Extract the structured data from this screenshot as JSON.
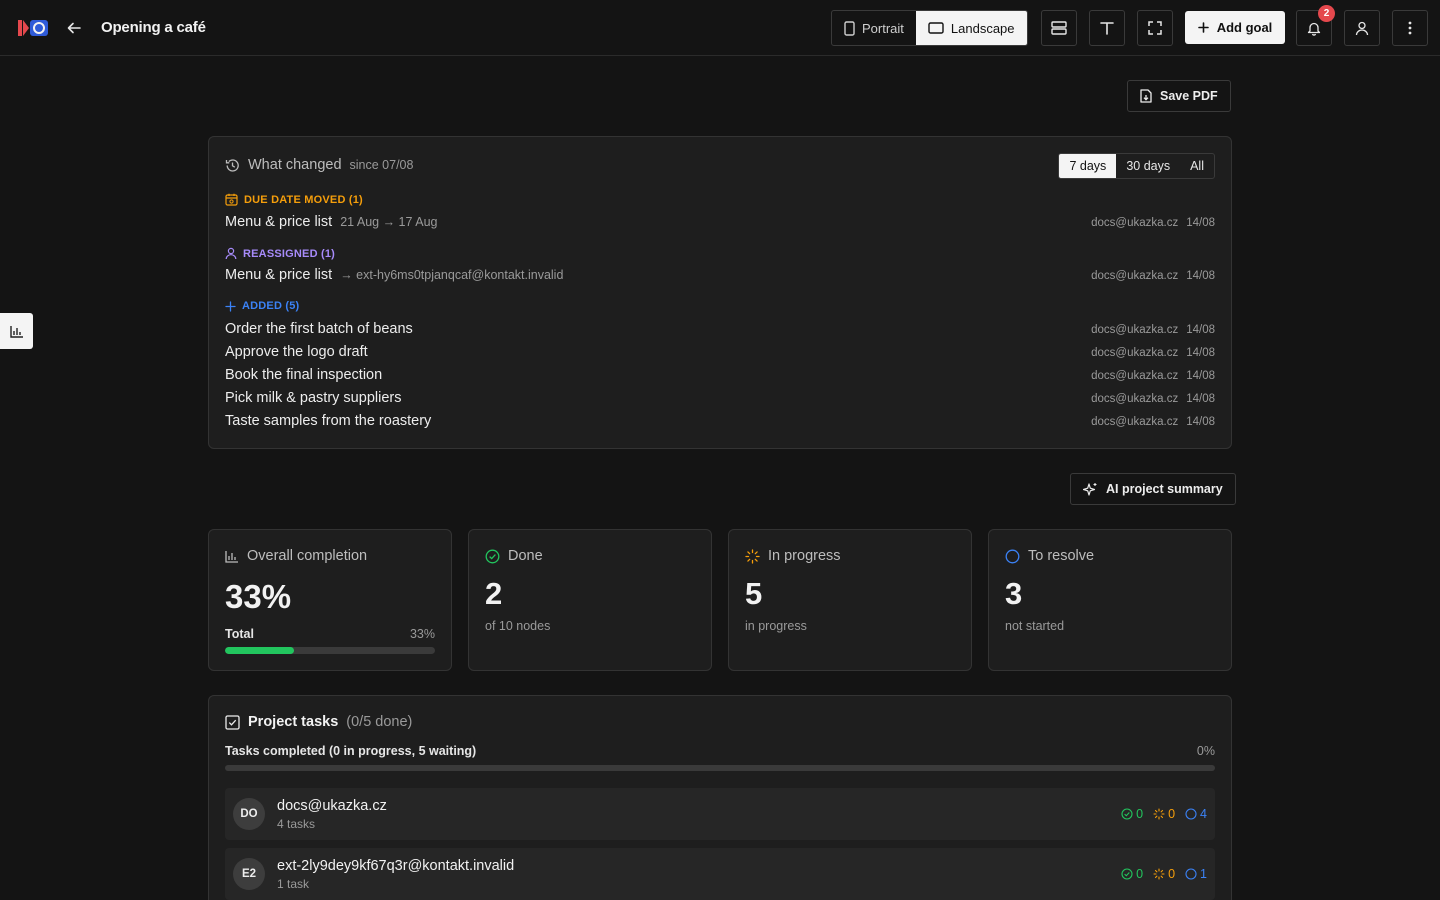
{
  "header": {
    "title": "Opening a café",
    "orientation": {
      "portrait": "Portrait",
      "landscape": "Landscape",
      "selected": "Landscape"
    },
    "add_goal": "Add goal",
    "notification_count": "2"
  },
  "toolbar": {
    "save_pdf": "Save PDF",
    "ai_summary": "AI project summary"
  },
  "what_changed": {
    "title": "What changed",
    "since": "since 07/08",
    "ranges": [
      "7 days",
      "30 days",
      "All"
    ],
    "selected_range": "7 days",
    "sections": [
      {
        "label": "DUE DATE MOVED (1)",
        "color": "#f59e0b",
        "items": [
          {
            "title": "Menu & price list",
            "detail": "21 Aug → 17 Aug",
            "user": "docs@ukazka.cz",
            "date": "14/08"
          }
        ]
      },
      {
        "label": "REASSIGNED (1)",
        "color": "#a78bfa",
        "items": [
          {
            "title": "Menu & price list",
            "detail": "→ ext-hy6ms0tpjanqcaf@kontakt.invalid",
            "user": "docs@ukazka.cz",
            "date": "14/08"
          }
        ]
      },
      {
        "label": "ADDED (5)",
        "color": "#3b82f6",
        "items": [
          {
            "title": "Order the first batch of beans",
            "detail": "",
            "user": "docs@ukazka.cz",
            "date": "14/08"
          },
          {
            "title": "Approve the logo draft",
            "detail": "",
            "user": "docs@ukazka.cz",
            "date": "14/08"
          },
          {
            "title": "Book the final inspection",
            "detail": "",
            "user": "docs@ukazka.cz",
            "date": "14/08"
          },
          {
            "title": "Pick milk & pastry suppliers",
            "detail": "",
            "user": "docs@ukazka.cz",
            "date": "14/08"
          },
          {
            "title": "Taste samples from the roastery",
            "detail": "",
            "user": "docs@ukazka.cz",
            "date": "14/08"
          }
        ]
      }
    ]
  },
  "stats": {
    "completion": {
      "title": "Overall completion",
      "value": "33%",
      "total_label": "Total",
      "total_pct": "33%",
      "progress": 0.33,
      "color": "#22c55e"
    },
    "done": {
      "title": "Done",
      "value": "2",
      "sub": "of 10 nodes",
      "color": "#22c55e"
    },
    "in_progress": {
      "title": "In progress",
      "value": "5",
      "sub": "in progress",
      "color": "#f59e0b"
    },
    "to_resolve": {
      "title": "To resolve",
      "value": "3",
      "sub": "not started",
      "color": "#3b82f6"
    }
  },
  "project_tasks": {
    "title": "Project tasks",
    "count": "(0/5 done)",
    "completed_label": "Tasks completed (0 in progress, 5 waiting)",
    "completed_pct": "0%",
    "progress": 0,
    "members": [
      {
        "initials": "DO",
        "name": "docs@ukazka.cz",
        "tasks": "4 tasks",
        "done": "0",
        "in_progress": "0",
        "waiting": "4"
      },
      {
        "initials": "E2",
        "name": "ext-2ly9dey9kf67q3r@kontakt.invalid",
        "tasks": "1 task",
        "done": "0",
        "in_progress": "0",
        "waiting": "1"
      }
    ]
  }
}
